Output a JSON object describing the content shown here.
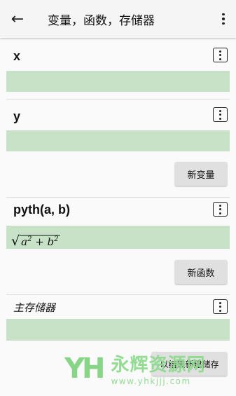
{
  "appbar": {
    "title": "变量，函数，存储器",
    "back_icon": "←"
  },
  "sections": [
    {
      "label": "x"
    },
    {
      "label": "y"
    },
    {
      "label": "pyth(a, b)",
      "formula_base1": "a",
      "formula_exp1": "2",
      "formula_plus": " + ",
      "formula_base2": "b",
      "formula_exp2": "2"
    },
    {
      "label": "主存储器"
    }
  ],
  "buttons": {
    "new_variable": "新变量",
    "new_function": "新函数",
    "bottom_partial": "以结果新建储存"
  },
  "watermark": {
    "logo": "YH",
    "name": "永辉资源网",
    "url": "www.yhkjjj.com"
  },
  "colors": {
    "value_bar": "#c8e2c8",
    "button_bg": "#e0e0e0",
    "watermark_green": "#8cd98c"
  }
}
